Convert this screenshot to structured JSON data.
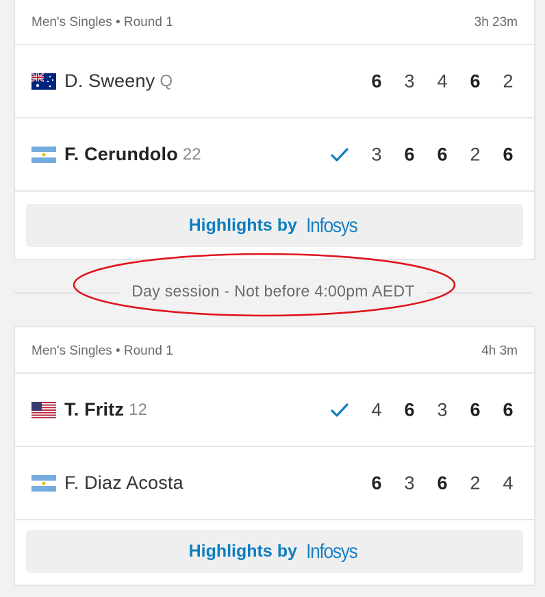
{
  "matches": [
    {
      "event": "Men's Singles • Round 1",
      "duration": "3h 23m",
      "players": [
        {
          "name": "D. Sweeny",
          "seed": "Q",
          "country": "AUS",
          "winner": false,
          "scores": [
            "6",
            "3",
            "4",
            "6",
            "2"
          ],
          "won_sets": [
            true,
            false,
            false,
            true,
            false
          ]
        },
        {
          "name": "F. Cerundolo",
          "seed": "22",
          "country": "ARG",
          "winner": true,
          "scores": [
            "3",
            "6",
            "6",
            "2",
            "6"
          ],
          "won_sets": [
            false,
            true,
            true,
            false,
            true
          ]
        }
      ],
      "highlights": {
        "label": "Highlights by",
        "brand": "Infosys"
      }
    },
    {
      "event": "Men's Singles • Round 1",
      "duration": "4h 3m",
      "players": [
        {
          "name": "T. Fritz",
          "seed": "12",
          "country": "USA",
          "winner": true,
          "scores": [
            "4",
            "6",
            "3",
            "6",
            "6"
          ],
          "won_sets": [
            false,
            true,
            false,
            true,
            true
          ]
        },
        {
          "name": "F. Diaz Acosta",
          "seed": "",
          "country": "ARG",
          "winner": false,
          "scores": [
            "6",
            "3",
            "6",
            "2",
            "4"
          ],
          "won_sets": [
            true,
            false,
            true,
            false,
            false
          ]
        }
      ],
      "highlights": {
        "label": "Highlights by",
        "brand": "Infosys"
      }
    }
  ],
  "session_divider": "Day session - Not before 4:00pm AEDT",
  "colors": {
    "accent": "#0f7fc0",
    "annotation": "#e0141e",
    "background": "#f2f2f2"
  },
  "icons": {
    "winner": "checkmark-icon",
    "flags": [
      "australia-flag-icon",
      "argentina-flag-icon",
      "usa-flag-icon"
    ]
  }
}
